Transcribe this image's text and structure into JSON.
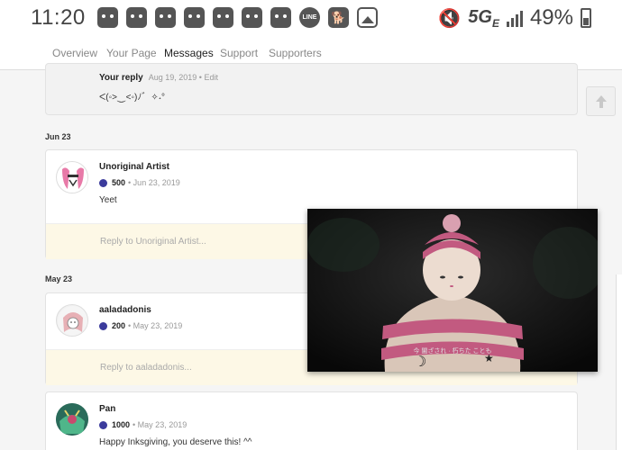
{
  "status_bar": {
    "time": "11:20",
    "network": "5G",
    "network_sub": "E",
    "battery": "49%",
    "line_label": "LINE"
  },
  "tabs": [
    {
      "label": "Overview",
      "active": false
    },
    {
      "label": "Your Page",
      "active": false
    },
    {
      "label": "Messages",
      "active": true
    },
    {
      "label": "Support",
      "active": false
    },
    {
      "label": "Supporters",
      "active": false
    }
  ],
  "top_reply": {
    "label": "Your reply",
    "date": "Aug 19, 2019",
    "edit": "• Edit",
    "text": "ᐸ(◦>⏝<◦)ﾉ゛✧˖°"
  },
  "groups": [
    {
      "date": "Jun 23",
      "name": "Unoriginal Artist",
      "points": "500",
      "when": "• Jun 23, 2019",
      "message": "Yeet",
      "reply_placeholder": "Reply to Unoriginal Artist..."
    },
    {
      "date": "May 23",
      "name": "aaladadonis",
      "points": "200",
      "when": "• May 23, 2019",
      "message": "",
      "reply_placeholder": "Reply to aaladadonis..."
    },
    {
      "date": "",
      "name": "Pan",
      "points": "1000",
      "when": "• May 23, 2019",
      "message": "Happy Inksgiving, you deserve this! ^^",
      "reply_placeholder": ""
    }
  ],
  "video": {
    "subtitle": "今 闇ざされ · 朽ちた ことも"
  },
  "colors": {
    "accent_coin": "#3b3b9c",
    "reply_bar": "#fdf8e6"
  }
}
